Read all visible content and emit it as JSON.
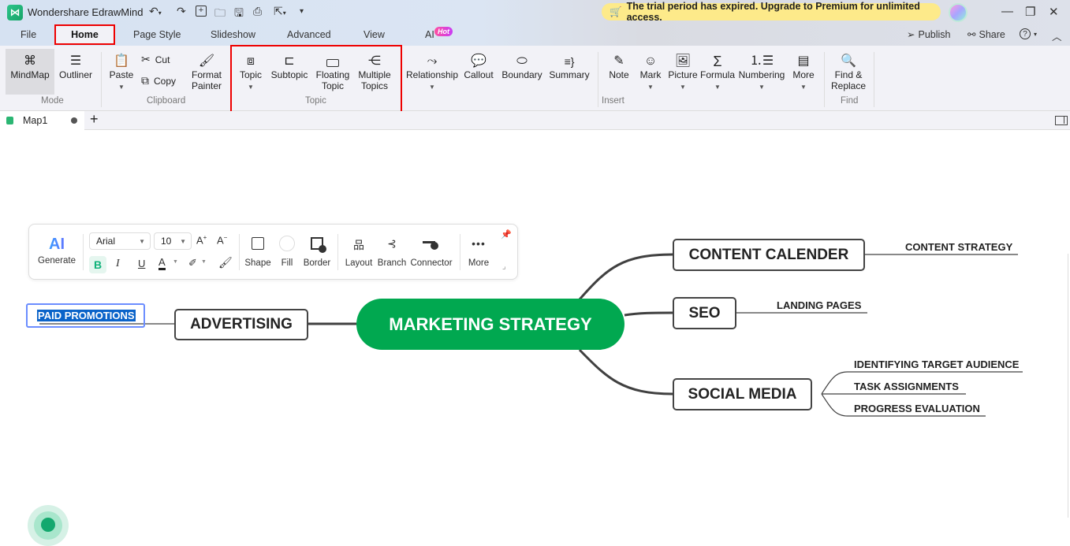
{
  "app": {
    "title": "Wondershare EdrawMind",
    "logo": "edrawmind-logo",
    "trial_banner": "The trial period has expired. Upgrade to Premium for unlimited access."
  },
  "menu": {
    "tabs": [
      {
        "label": "File"
      },
      {
        "label": "Home",
        "active": true
      },
      {
        "label": "Page Style"
      },
      {
        "label": "Slideshow"
      },
      {
        "label": "Advanced"
      },
      {
        "label": "View"
      },
      {
        "label": "AI",
        "badge": "Hot"
      }
    ],
    "publish": "Publish",
    "share": "Share"
  },
  "ribbon": {
    "mode": {
      "group": "Mode",
      "items": [
        "MindMap",
        "Outliner"
      ]
    },
    "clipboard": {
      "group": "Clipboard",
      "paste": "Paste",
      "cut": "Cut",
      "copy": "Copy",
      "format_painter_1": "Format",
      "format_painter_2": "Painter"
    },
    "topic": {
      "group": "Topic",
      "topic": "Topic",
      "subtopic": "Subtopic",
      "floating_1": "Floating",
      "floating_2": "Topic",
      "multiple_1": "Multiple",
      "multiple_2": "Topics"
    },
    "insert": {
      "group": "Insert",
      "relationship": "Relationship",
      "callout": "Callout",
      "boundary": "Boundary",
      "summary": "Summary",
      "note": "Note",
      "mark": "Mark",
      "picture": "Picture",
      "formula": "Formula",
      "numbering": "Numbering",
      "more": "More"
    },
    "find": {
      "group": "Find",
      "label_1": "Find &",
      "label_2": "Replace"
    }
  },
  "document_tab": {
    "name": "Map1",
    "unsaved": true
  },
  "floating_toolbar": {
    "ai_label": "AI",
    "generate": "Generate",
    "font": "Arial",
    "size": "10",
    "bold": "B",
    "italic": "I",
    "underline": "U",
    "font_color": "A",
    "shape": "Shape",
    "fill": "Fill",
    "border": "Border",
    "layout": "Layout",
    "branch": "Branch",
    "connector": "Connector",
    "more": "More"
  },
  "mindmap": {
    "central": "MARKETING STRATEGY",
    "left": {
      "topic": "ADVERTISING",
      "subtopics": [
        "PAID PROMOTIONS"
      ]
    },
    "right": [
      {
        "topic": "CONTENT CALENDER",
        "subtopics": [
          "CONTENT STRATEGY"
        ]
      },
      {
        "topic": "SEO",
        "subtopics": [
          "LANDING PAGES"
        ]
      },
      {
        "topic": "SOCIAL MEDIA",
        "subtopics": [
          "IDENTIFYING TARGET AUDIENCE",
          "TASK ASSIGNMENTS",
          "PROGRESS EVALUATION"
        ]
      }
    ],
    "selected": "PAID PROMOTIONS",
    "colors": {
      "central": "#01a850",
      "selection": "#0a63c9"
    }
  }
}
